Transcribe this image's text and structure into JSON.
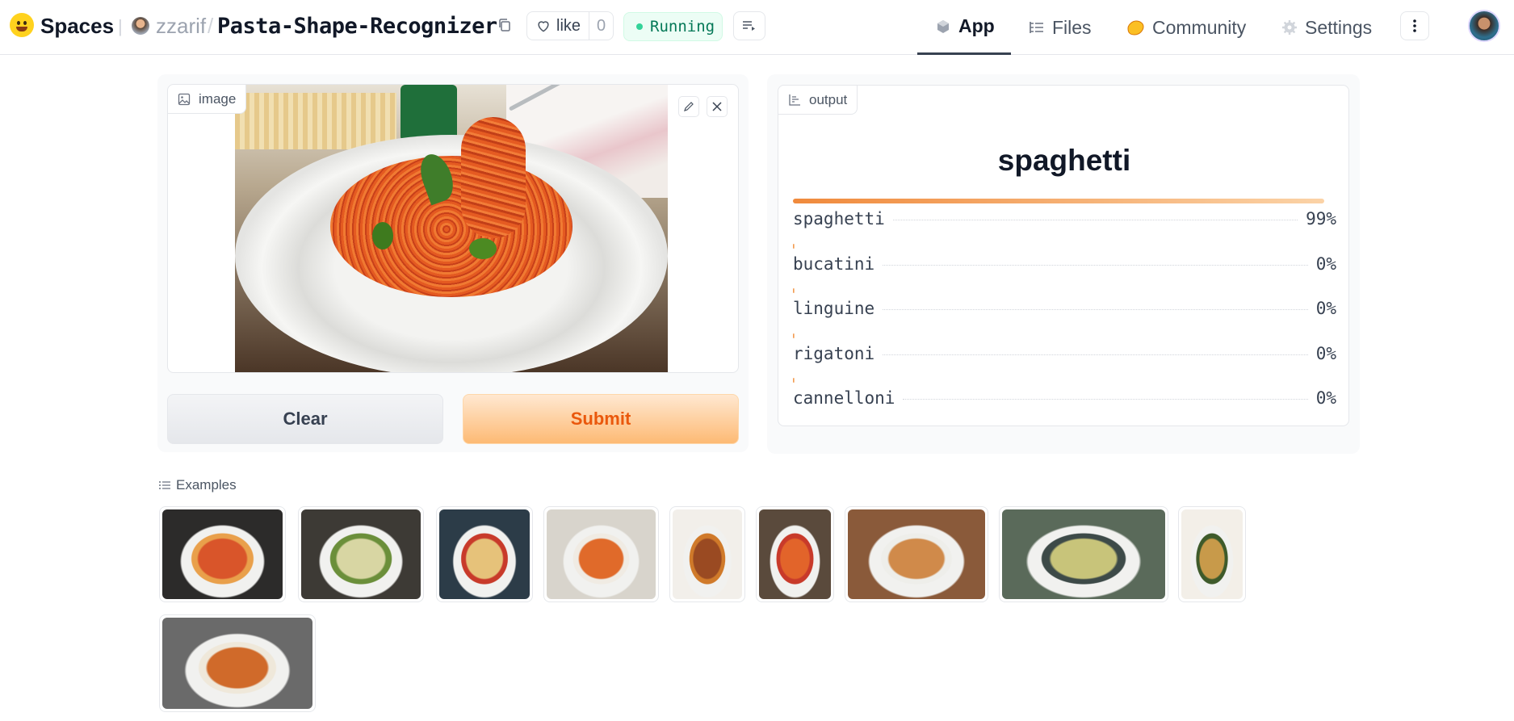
{
  "header": {
    "brand": "Spaces",
    "owner": "zzarif",
    "repo": "Pasta-Shape-Recognizer",
    "like_label": "like",
    "like_count": "0",
    "status": "Running",
    "nav": {
      "app": "App",
      "files": "Files",
      "community": "Community",
      "settings": "Settings"
    }
  },
  "input": {
    "label": "image",
    "clear_label": "Clear",
    "submit_label": "Submit"
  },
  "output": {
    "label": "output",
    "top_prediction": "spaghetti",
    "confidences": [
      {
        "name": "spaghetti",
        "value": "99%",
        "score": 0.99
      },
      {
        "name": "bucatini",
        "value": "0%",
        "score": 0.0
      },
      {
        "name": "linguine",
        "value": "0%",
        "score": 0.0
      },
      {
        "name": "rigatoni",
        "value": "0%",
        "score": 0.0
      },
      {
        "name": "cannelloni",
        "value": "0%",
        "score": 0.0
      }
    ]
  },
  "examples": {
    "label": "Examples",
    "items": [
      {
        "colors": [
          "#2c2b2a",
          "#d9552a",
          "#e9a04b"
        ]
      },
      {
        "colors": [
          "#3d3a35",
          "#d8d6a3",
          "#6b8f3a"
        ]
      },
      {
        "colors": [
          "#2c3c48",
          "#e6c27a",
          "#c83a2a"
        ]
      },
      {
        "colors": [
          "#d8d4cc",
          "#e06a2a",
          "#f0ebe3"
        ]
      },
      {
        "colors": [
          "#f2efea",
          "#9a4a22",
          "#d07a2a"
        ]
      },
      {
        "colors": [
          "#5a4a3c",
          "#e2642a",
          "#c83a2a"
        ]
      },
      {
        "colors": [
          "#8a5a3a",
          "#d08a4a",
          "#eeeeea"
        ]
      },
      {
        "colors": [
          "#5a6a5a",
          "#c8c47a",
          "#3d4a48"
        ]
      },
      {
        "colors": [
          "#f3efe8",
          "#c89a4a",
          "#3e5a2a"
        ]
      },
      {
        "colors": [
          "#6a6a6a",
          "#d06a2a",
          "#efe8da"
        ]
      }
    ]
  }
}
